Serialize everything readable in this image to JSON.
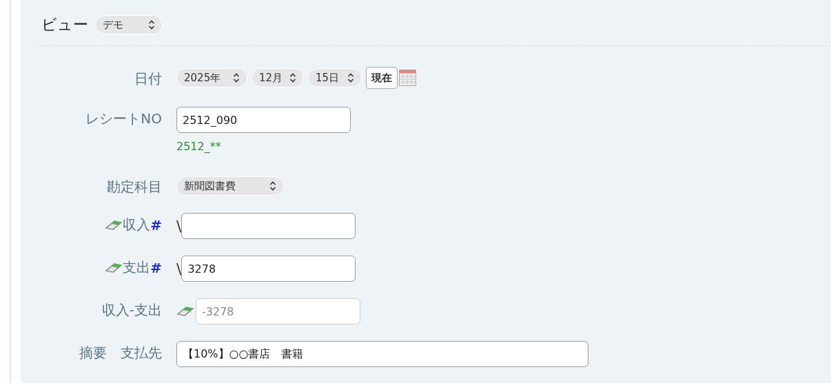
{
  "view": {
    "label": "ビュー",
    "value": "デモ"
  },
  "rows": [
    {
      "kind": "date",
      "label": "日付",
      "selects": [
        "2025年",
        "12月",
        "15日"
      ],
      "button": "現在"
    },
    {
      "kind": "text",
      "label": "レシートNO",
      "value": "2512_090",
      "hint": "2512_**"
    },
    {
      "kind": "select",
      "label": "勘定科目",
      "value": "新聞図書費"
    },
    {
      "kind": "amount",
      "label": "収入",
      "mark": "#",
      "prefix": "\\"
    },
    {
      "kind": "amount",
      "label": "支出",
      "mark": "#",
      "prefix": "\\",
      "value": "3278"
    },
    {
      "kind": "computed",
      "label": "収入-支出",
      "placeholder": "-3278"
    },
    {
      "kind": "wide",
      "labels": [
        "摘要",
        "支払先"
      ],
      "value": "【10%】○○書店　書籍"
    }
  ]
}
